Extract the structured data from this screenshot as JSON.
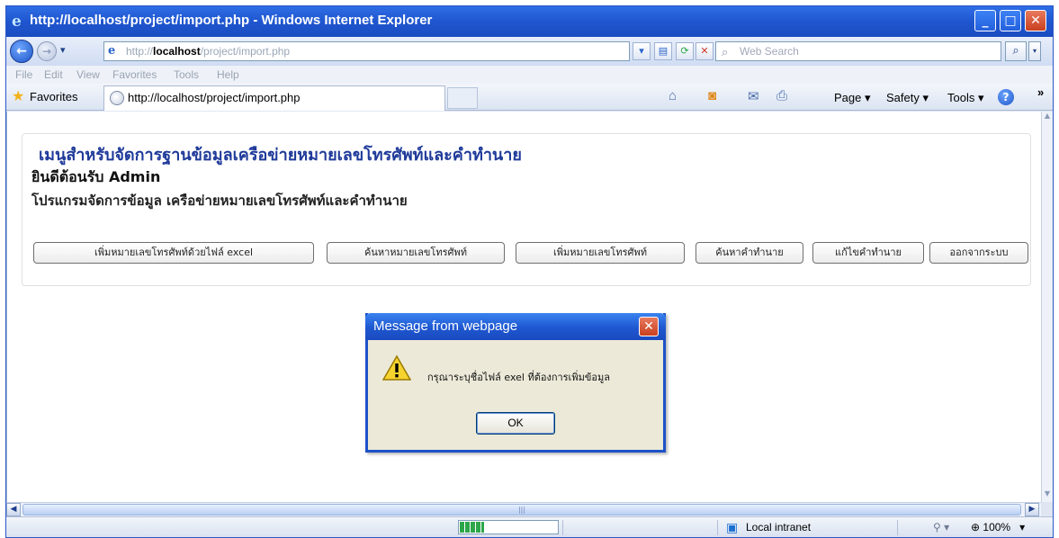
{
  "window": {
    "title": "http://localhost/project/import.php - Windows Internet Explorer",
    "minimize": "_",
    "maximize": "□",
    "close": "✕"
  },
  "address": {
    "back": "←",
    "forward": "→",
    "dropdown": "▾",
    "prefix": "http://",
    "host": "localhost",
    "path": "/project/import.php",
    "search_placeholder": "Web Search"
  },
  "menu": [
    "File",
    "Edit",
    "View",
    "Favorites",
    "Tools",
    "Help"
  ],
  "favorites_label": "Favorites",
  "tab": {
    "title": "http://localhost/project/import.php"
  },
  "commands": {
    "page": "Page ▾",
    "safety": "Safety ▾",
    "tools": "Tools ▾",
    "help": "?",
    "overflow": "»"
  },
  "page": {
    "heading": "เมนูสำหรับจัดการฐานข้อมูลเครือข่ายหมายเลขโทรศัพท์และคำทำนาย",
    "welcome": "ยินดีต้อนรับ Admin",
    "subtitle": "โปรแกรมจัดการข้อมูล เครือข่ายหมายเลขโทรศัพท์และคำทำนาย",
    "buttons": [
      "เพิ่มหมายเลขโทรศัพท์ด้วยไฟล์ excel",
      "ค้นหาหมายเลขโทรศัพท์",
      "เพิ่มหมายเลขโทรศัพท์",
      "ค้นหาคำทำนาย",
      "แก้ไขคำทำนาย",
      "ออกจากระบบ"
    ]
  },
  "status": {
    "zone": "Local intranet",
    "zoom": "100%",
    "progress": 0.25
  },
  "dialog": {
    "title": "Message from webpage",
    "message": "กรุณาระบุชื่อไฟล์ exel ที่ต้องการเพิ่มข้อมูล",
    "ok": "OK",
    "close": "✕"
  }
}
